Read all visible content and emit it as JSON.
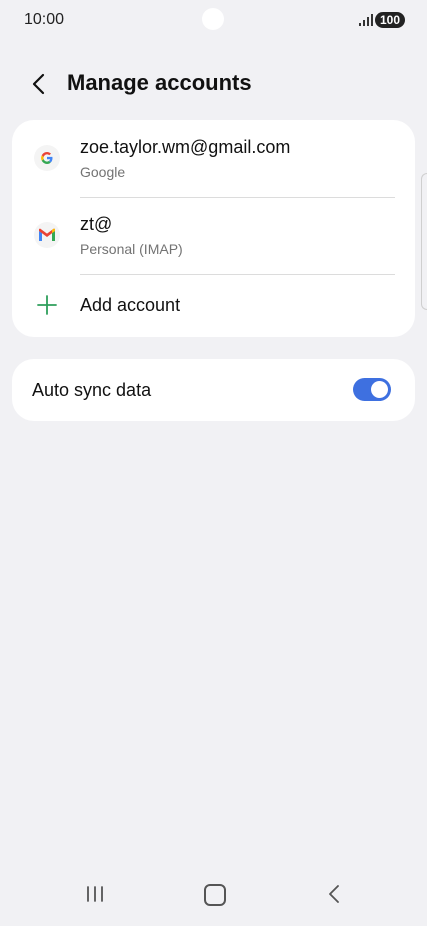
{
  "status": {
    "time": "10:00",
    "battery": "100"
  },
  "header": {
    "title": "Manage accounts"
  },
  "accounts": [
    {
      "primary": "zoe.taylor.wm@gmail.com",
      "secondary": "Google",
      "icon": "google-icon"
    },
    {
      "primary": "zt@",
      "secondary": "Personal (IMAP)",
      "icon": "gmail-icon"
    }
  ],
  "add_account": {
    "label": "Add account",
    "icon": "plus-icon"
  },
  "sync": {
    "label": "Auto sync data",
    "enabled": true
  },
  "colors": {
    "toggle_on": "#3e70e0",
    "plus": "#2e9e5b",
    "background": "#f1f1f4"
  }
}
